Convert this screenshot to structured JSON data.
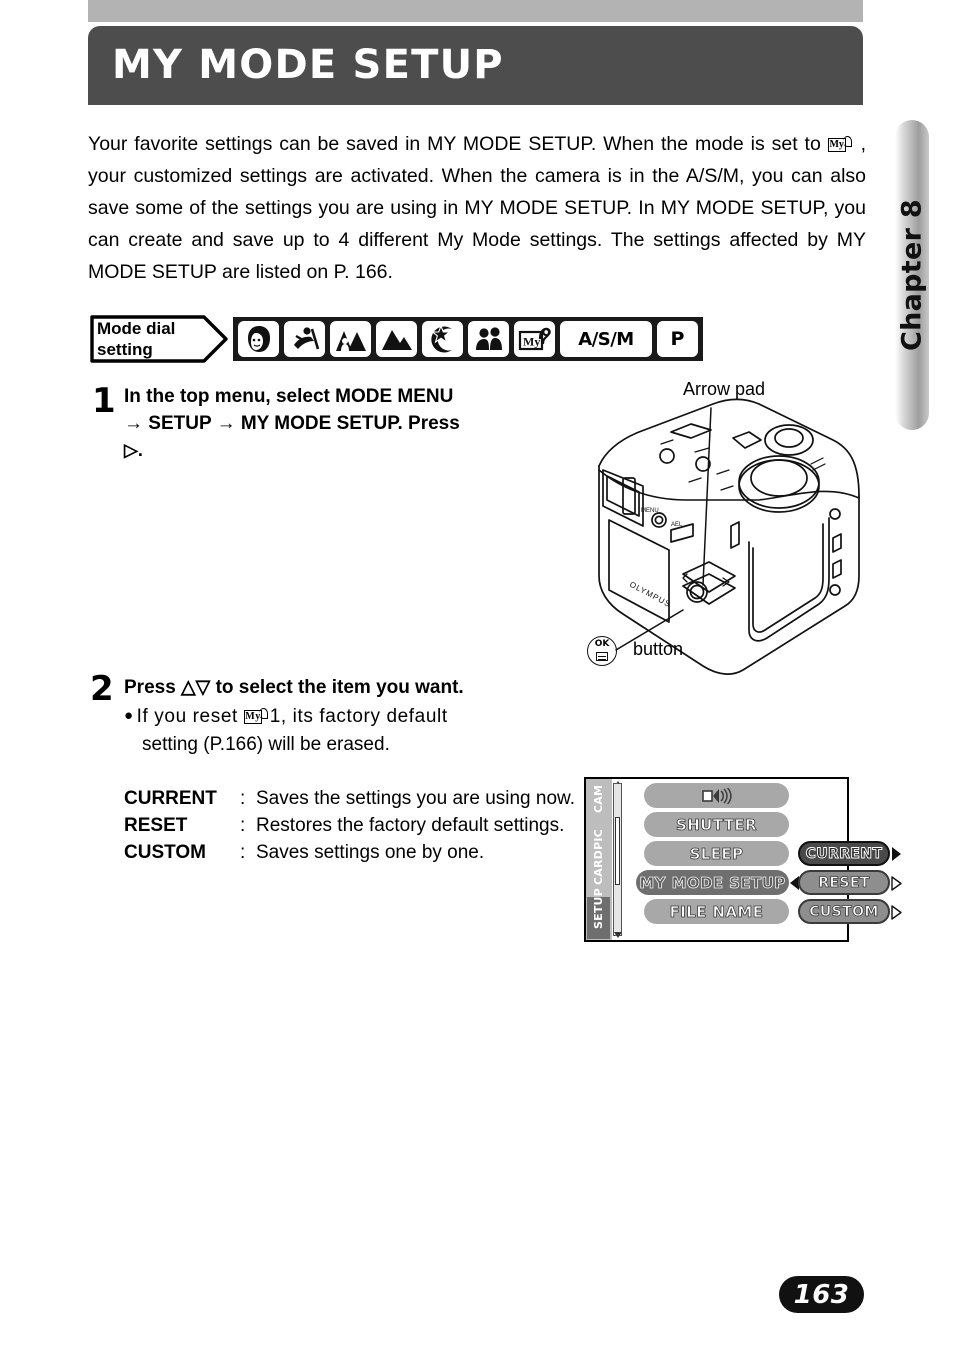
{
  "header": {
    "title": "MY MODE SETUP"
  },
  "chapter_tab": {
    "label": "Chapter 8"
  },
  "intro": {
    "part1": "Your favorite settings can be saved in MY MODE SETUP. When the mode is set to",
    "part2": ", your customized settings are activated. When the camera is in the A/S/M, you can also save some of the settings you are using in MY MODE SETUP. In MY MODE SETUP, you can create and save up to 4 different My Mode settings. The settings affected by MY MODE SETUP are listed on P. 166."
  },
  "mode_dial": {
    "label_line1": "Mode dial",
    "label_line2": "setting",
    "icons": [
      {
        "name": "portrait-mode-icon",
        "text": ""
      },
      {
        "name": "sports-mode-icon",
        "text": ""
      },
      {
        "name": "portrait-landscape-mode-icon",
        "text": ""
      },
      {
        "name": "landscape-mode-icon",
        "text": ""
      },
      {
        "name": "night-scene-mode-icon",
        "text": ""
      },
      {
        "name": "self-portrait-mode-icon",
        "text": ""
      },
      {
        "name": "my-mode-icon",
        "text": "My"
      },
      {
        "name": "asm-mode-icon",
        "text": "A/S/M"
      },
      {
        "name": "program-mode-icon",
        "text": "P"
      }
    ]
  },
  "step1": {
    "number": "1",
    "line1": "In the top menu, select MODE MENU",
    "arrow": "→",
    "line2a": "SETUP",
    "line2b": "MY MODE SETUP. Press",
    "line3": "▷."
  },
  "step2": {
    "number": "2",
    "heading_a": "Press ",
    "heading_up": "△",
    "heading_dn": "▽",
    "heading_b": " to select the item you want.",
    "bullet_a": "If you reset ",
    "bullet_mymode": "1",
    "bullet_b": ", its factory default",
    "bullet_c": "setting (P.166) will be erased."
  },
  "definitions": [
    {
      "term": "CURRENT",
      "colon": ":",
      "desc": "Saves the settings you are using now."
    },
    {
      "term": "RESET",
      "colon": ":",
      "desc": "Restores the factory default settings."
    },
    {
      "term": "CUSTOM",
      "colon": ":",
      "desc": "Saves settings one by one."
    }
  ],
  "camera_figure": {
    "arrow_pad_label": "Arrow pad",
    "ok_button_label": "button",
    "brand": "OLYMPUS"
  },
  "lcd_menu": {
    "tabs": [
      {
        "label": "CAM",
        "selected": false
      },
      {
        "label": "PIC",
        "selected": false
      },
      {
        "label": "CARD",
        "selected": false
      },
      {
        "label": "SETUP",
        "selected": true
      }
    ],
    "items": [
      {
        "label": "",
        "icon": "beep-icon",
        "selected": false
      },
      {
        "label": "SHUTTER",
        "icon": "",
        "selected": false
      },
      {
        "label": "SLEEP",
        "icon": "",
        "selected": false
      },
      {
        "label": "MY MODE SETUP",
        "icon": "",
        "selected": true
      },
      {
        "label": "FILE NAME",
        "icon": "",
        "selected": false
      }
    ],
    "options": [
      {
        "label": "CURRENT",
        "selected": true
      },
      {
        "label": "RESET",
        "selected": false
      },
      {
        "label": "CUSTOM",
        "selected": false
      }
    ]
  },
  "page_number": "163",
  "colors": {
    "header_bg": "#4d4d4d",
    "top_band": "#b3b3b3",
    "dial_strip": "#1a1a1a",
    "lcd_item": "#a8a8a8",
    "lcd_item_selected": "#6f6f6f",
    "page_pill": "#111111"
  }
}
